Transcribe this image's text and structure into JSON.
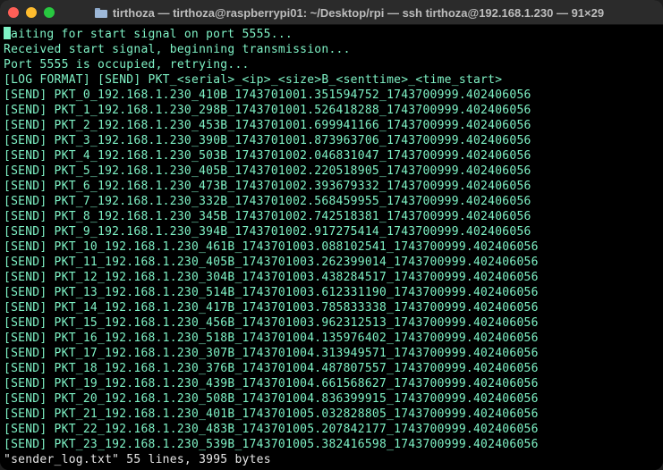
{
  "window": {
    "title": "tirthoza — tirthoza@raspberrypi01: ~/Desktop/rpi — ssh tirthoza@192.168.1.230 — 91×29"
  },
  "terminal": {
    "first_line": "aiting for start signal on port 5555...",
    "lines": [
      "Received start signal, beginning transmission...",
      "Port 5555 is occupied, retrying...",
      "[LOG FORMAT] [SEND] PKT_<serial>_<ip>_<size>B_<senttime>_<time_start>",
      "[SEND] PKT_0_192.168.1.230_410B_1743701001.351594752_1743700999.402406056",
      "[SEND] PKT_1_192.168.1.230_298B_1743701001.526418288_1743700999.402406056",
      "[SEND] PKT_2_192.168.1.230_453B_1743701001.699941166_1743700999.402406056",
      "[SEND] PKT_3_192.168.1.230_390B_1743701001.873963706_1743700999.402406056",
      "[SEND] PKT_4_192.168.1.230_503B_1743701002.046831047_1743700999.402406056",
      "[SEND] PKT_5_192.168.1.230_405B_1743701002.220518905_1743700999.402406056",
      "[SEND] PKT_6_192.168.1.230_473B_1743701002.393679332_1743700999.402406056",
      "[SEND] PKT_7_192.168.1.230_332B_1743701002.568459955_1743700999.402406056",
      "[SEND] PKT_8_192.168.1.230_345B_1743701002.742518381_1743700999.402406056",
      "[SEND] PKT_9_192.168.1.230_394B_1743701002.917275414_1743700999.402406056",
      "[SEND] PKT_10_192.168.1.230_461B_1743701003.088102541_1743700999.402406056",
      "[SEND] PKT_11_192.168.1.230_405B_1743701003.262399014_1743700999.402406056",
      "[SEND] PKT_12_192.168.1.230_304B_1743701003.438284517_1743700999.402406056",
      "[SEND] PKT_13_192.168.1.230_514B_1743701003.612331190_1743700999.402406056",
      "[SEND] PKT_14_192.168.1.230_417B_1743701003.785833338_1743700999.402406056",
      "[SEND] PKT_15_192.168.1.230_456B_1743701003.962312513_1743700999.402406056",
      "[SEND] PKT_16_192.168.1.230_518B_1743701004.135976402_1743700999.402406056",
      "[SEND] PKT_17_192.168.1.230_307B_1743701004.313949571_1743700999.402406056",
      "[SEND] PKT_18_192.168.1.230_376B_1743701004.487807557_1743700999.402406056",
      "[SEND] PKT_19_192.168.1.230_439B_1743701004.661568627_1743700999.402406056",
      "[SEND] PKT_20_192.168.1.230_508B_1743701004.836399915_1743700999.402406056",
      "[SEND] PKT_21_192.168.1.230_401B_1743701005.032828805_1743700999.402406056",
      "[SEND] PKT_22_192.168.1.230_483B_1743701005.207842177_1743700999.402406056",
      "[SEND] PKT_23_192.168.1.230_539B_1743701005.382416598_1743700999.402406056"
    ],
    "status_line": "\"sender_log.txt\" 55 lines, 3995 bytes"
  },
  "colors": {
    "text": "#7ff3c6",
    "status_text": "#e6e6e6",
    "background": "#000000",
    "titlebar": "#2b2b2b",
    "close": "#ff5f57",
    "minimize": "#febc2e",
    "maximize": "#28c840"
  },
  "icons": {
    "title_icon": "folder-icon",
    "close": "close-button-icon",
    "minimize": "minimize-button-icon",
    "maximize": "maximize-button-icon"
  }
}
